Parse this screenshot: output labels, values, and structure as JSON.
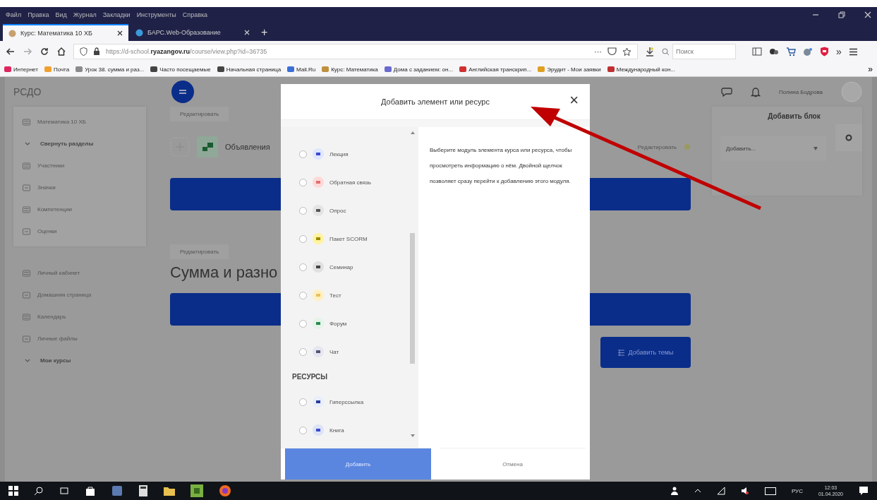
{
  "browser": {
    "menu": [
      "Файл",
      "Правка",
      "Вид",
      "Журнал",
      "Закладки",
      "Инструменты",
      "Справка"
    ],
    "tabs": [
      {
        "title": "Курс: Математика 10 ХБ",
        "selected": true
      },
      {
        "title": "БАРС.Web-Образование",
        "selected": false
      }
    ],
    "new_tab": "+",
    "address": {
      "url": "https://d-school.**ryazangov.ru**/course/view.php?id=36735"
    },
    "more": "···",
    "search": {
      "placeholder": "Поиск"
    },
    "overflow": "»",
    "bookmarks": [
      {
        "label": "Интернет",
        "color": "#e0245e"
      },
      {
        "label": "Почта",
        "color": "#f0a030"
      },
      {
        "label": "Урок 38. сумма и раз...",
        "color": "#8a8a8a"
      },
      {
        "label": "Часто посещаемые",
        "color": "#444444"
      },
      {
        "label": "Начальная страница",
        "color": "#444444"
      },
      {
        "label": "Mail.Ru",
        "color": "#3a6fd8"
      },
      {
        "label": "Курс: Математика",
        "color": "#c09040"
      },
      {
        "label": "Дома с заданием: он...",
        "color": "#6a6ad0"
      },
      {
        "label": "Английская транскрип...",
        "color": "#d03030"
      },
      {
        "label": "Эрудит - Мои заявки",
        "color": "#e0a020"
      },
      {
        "label": "Международный кон...",
        "color": "#c03030"
      }
    ],
    "bookmarks_more": "»"
  },
  "site": {
    "logo": "РСДО",
    "user_name": "Полина Бодрова"
  },
  "sidebar": {
    "groups": [
      [
        {
          "label": "Математика 10 ХБ",
          "kind": "link"
        },
        {
          "label": "Свернуть разделы",
          "kind": "toggle"
        },
        {
          "label": "Участники",
          "kind": "link"
        },
        {
          "label": "Значки",
          "kind": "link"
        },
        {
          "label": "Компетенции",
          "kind": "link"
        },
        {
          "label": "Оценки",
          "kind": "link"
        }
      ],
      [
        {
          "label": "Личный кабинет",
          "kind": "link"
        },
        {
          "label": "Домашняя страница",
          "kind": "link"
        },
        {
          "label": "Календарь",
          "kind": "link"
        },
        {
          "label": "Личные файлы",
          "kind": "link"
        },
        {
          "label": "Мои курсы",
          "kind": "toggle"
        }
      ]
    ]
  },
  "main": {
    "edit_top": "Редактировать",
    "activity": "Объявления",
    "activity_edit": "Редактировать",
    "edit_section": "Редактировать",
    "section_title": "Сумма и разно",
    "add_topic": "Добавить темы"
  },
  "blocks": {
    "title": "Добавить блок",
    "select_placeholder": "Добавить..."
  },
  "modal": {
    "title": "Добавить элемент или ресурс",
    "close": "×",
    "items": [
      {
        "kind": "module",
        "label": "Лекция",
        "color": "#dfe6ff",
        "selected": false
      },
      {
        "kind": "module",
        "label": "Обратная связь",
        "color": "#ffd9d9",
        "selected": false
      },
      {
        "kind": "module",
        "label": "Опрос",
        "color": "#e4e4e4",
        "selected": false
      },
      {
        "kind": "module",
        "label": "Пакет SCORM",
        "color": "#fff3a0",
        "selected": false
      },
      {
        "kind": "module",
        "label": "Семинар",
        "color": "#e0e0e0",
        "selected": false
      },
      {
        "kind": "module",
        "label": "Тест",
        "color": "#fff0c0",
        "selected": false
      },
      {
        "kind": "module",
        "label": "Форум",
        "color": "#e4f4e8",
        "selected": false
      },
      {
        "kind": "module",
        "label": "Чат",
        "color": "#e6e6f0",
        "selected": false
      },
      {
        "kind": "heading",
        "label": "РЕСУРСЫ"
      },
      {
        "kind": "module",
        "label": "Гиперссылка",
        "color": "#e8eefa",
        "selected": false
      },
      {
        "kind": "module",
        "label": "Книга",
        "color": "#dde3f5",
        "selected": false
      }
    ],
    "description": "Выберите модуль элемента курса или ресурса, чтобы просмотреть информацию о нём. Двойной щелчок позволяет сразу перейти к добавлению этого модуля.",
    "buttons": [
      {
        "label": "Добавить",
        "kind": "primary"
      },
      {
        "label": "Отмена",
        "kind": "secondary"
      }
    ]
  },
  "taskbar": {
    "language": "РУС",
    "time": "12:03",
    "date": "01.04.2020"
  }
}
